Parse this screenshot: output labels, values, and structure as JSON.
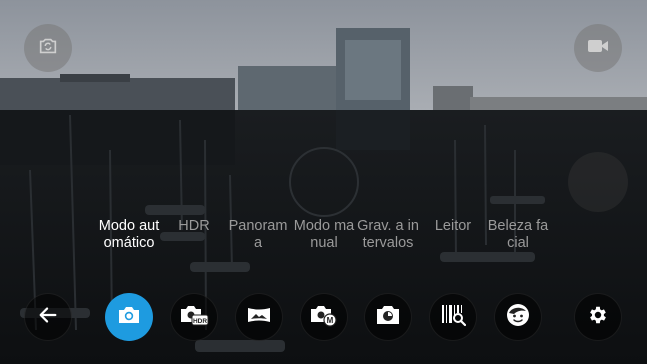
{
  "top_controls": {
    "switch_camera_icon": "camera-switch-icon",
    "video_icon": "video-camera-icon"
  },
  "modes": [
    {
      "label": "Modo automático",
      "icon": "camera-icon",
      "active": true
    },
    {
      "label": "HDR",
      "icon": "hdr-camera-icon",
      "active": false
    },
    {
      "label": "Panorama",
      "icon": "panorama-icon",
      "active": false
    },
    {
      "label": "Modo manual",
      "icon": "manual-camera-icon",
      "active": false
    },
    {
      "label": "Grav. a intervalos",
      "icon": "timelapse-icon",
      "active": false
    },
    {
      "label": "Leitor",
      "icon": "barcode-scanner-icon",
      "active": false
    },
    {
      "label": "Beleza facial",
      "icon": "face-beauty-icon",
      "active": false
    }
  ],
  "back_icon": "back-arrow-icon",
  "settings_icon": "gear-icon",
  "colors": {
    "accent": "#1e9be0",
    "label_active": "#ffffff",
    "label_inactive": "#9a9a9a"
  }
}
